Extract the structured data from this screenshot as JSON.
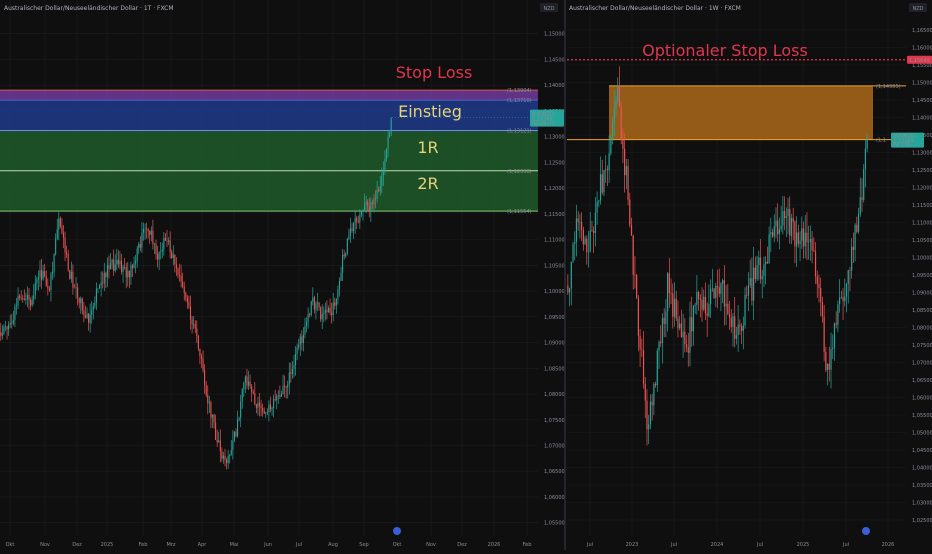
{
  "colors": {
    "background": "#0f0f10",
    "grid": "#1c1d22",
    "up": "#26a69a",
    "down": "#ef5350",
    "stop_red": "#e0364d",
    "label_yellow": "#e7d27a",
    "orange": "#f0a22f",
    "separator": "#2a2e39"
  },
  "charts": [
    {
      "id": "left",
      "title": "Australischer Dollar/Neuseeländischer Dollar · 1T · FXCM",
      "currency": "NZD",
      "price_labels": [
        "1,15000",
        "1,14500",
        "1,14000",
        "1,13500",
        "1,13000",
        "1,12500",
        "1,12000",
        "1,11500",
        "1,11000",
        "1,10500",
        "1,10000",
        "1,09500",
        "1,09000",
        "1,08500",
        "1,08000",
        "1,07500",
        "1,07000",
        "1,06500",
        "1,06000",
        "1,05500"
      ],
      "time_labels": [
        "Okt",
        "Nov",
        "Dez",
        "2025",
        "Feb",
        "Mrz",
        "Apr",
        "Mai",
        "Jun",
        "Jul",
        "Aug",
        "Sep",
        "Okt",
        "Nov",
        "Dez",
        "2026",
        "Feb"
      ],
      "current_price_label": {
        "line1": "AUDNZD",
        "line2": "1,13369",
        "line3": "06:59:07"
      },
      "annotations": {
        "stop": "Stop Loss",
        "entry": "Einstieg",
        "one_r": "1R",
        "two_r": "2R"
      },
      "zone_labels": {
        "stop": "(1,13904)",
        "purple_low": "(1,13710)",
        "entry": "(1,13121)",
        "one_r": "(1,12338)",
        "two_r": "(1,11554)"
      }
    },
    {
      "id": "right",
      "title": "Australischer Dollar/Neuseeländischer Dollar · 1W · FXCM",
      "currency": "NZD",
      "price_labels": [
        "1,16500",
        "1,16000",
        "1,15500",
        "1,15000",
        "1,14500",
        "1,14000",
        "1,13500",
        "1,13000",
        "1,12500",
        "1,12000",
        "1,11500",
        "1,11000",
        "1,10500",
        "1,10000",
        "1,09500",
        "1,09000",
        "1,08500",
        "1,08000",
        "1,07500",
        "1,07000",
        "1,06500",
        "1,06000",
        "1,05500",
        "1,05000",
        "1,04500",
        "1,04000",
        "1,03500",
        "1,03000",
        "1,02500"
      ],
      "time_labels": [
        "Jul",
        "2023",
        "Jul",
        "2024",
        "Jul",
        "2025",
        "Jul",
        "2026"
      ],
      "stop_tag": "1,15649",
      "current_price_label": {
        "line1": "AUDNZD",
        "line2": "1,13369",
        "line3": "0d 17h"
      },
      "annotations": {
        "optional_stop": "Optionaler Stop Loss"
      },
      "zone_labels": {
        "top": "(1,14905)",
        "bottom": "(1,1"
      }
    }
  ],
  "chart_data": [
    {
      "type": "candlestick",
      "title": "Australischer Dollar/Neuseeländischer Dollar · 1T · FXCM",
      "interval": "1T",
      "y_unit": "NZD",
      "ylim": [
        1.053,
        1.155
      ],
      "x_start": "Okt 2024",
      "x_end": "Feb 2026",
      "grid": true,
      "close_path": [
        {
          "t": "Okt",
          "v": 1.092
        },
        {
          "t": "Nov",
          "v": 1.1
        },
        {
          "t": "Dez",
          "v": 1.114
        },
        {
          "t": "2025",
          "v": 1.101
        },
        {
          "t": "Feb",
          "v": 1.113
        },
        {
          "t": "Mrz",
          "v": 1.107
        },
        {
          "t": "Apr",
          "v": 1.072
        },
        {
          "t": "Mai",
          "v": 1.083
        },
        {
          "t": "Jun",
          "v": 1.079
        },
        {
          "t": "Jul",
          "v": 1.089
        },
        {
          "t": "Aug",
          "v": 1.095
        },
        {
          "t": "Sep",
          "v": 1.117
        },
        {
          "t": "Sep-end",
          "v": 1.1337
        }
      ],
      "last_price": 1.13369,
      "zones": [
        {
          "name": "Stop Loss",
          "from": 1.1371,
          "to": 1.13904,
          "color": "#7b3fa8"
        },
        {
          "name": "Einstieg",
          "from": 1.13121,
          "to": 1.1371,
          "color": "#1f3f9c"
        },
        {
          "name": "1R",
          "from": 1.12338,
          "to": 1.13121,
          "color": "#1f5a2a"
        },
        {
          "name": "2R",
          "from": 1.11554,
          "to": 1.12338,
          "color": "#1f5a2a"
        }
      ]
    },
    {
      "type": "candlestick",
      "title": "Australischer Dollar/Neuseeländischer Dollar · 1W · FXCM",
      "interval": "1W",
      "y_unit": "NZD",
      "ylim": [
        1.02,
        1.168
      ],
      "x_start": "Apr 2022",
      "x_end": "Okt 2026",
      "grid": true,
      "close_path": [
        {
          "t": "Jul 2022",
          "v": 1.115
        },
        {
          "t": "Nov 2022",
          "v": 1.148
        },
        {
          "t": "Jan 2023",
          "v": 1.052
        },
        {
          "t": "Jul 2023",
          "v": 1.085
        },
        {
          "t": "2024",
          "v": 1.095
        },
        {
          "t": "Jul 2024",
          "v": 1.113
        },
        {
          "t": "2025",
          "v": 1.104
        },
        {
          "t": "Apr 2025",
          "v": 1.065
        },
        {
          "t": "Jul 2025",
          "v": 1.098
        },
        {
          "t": "Sep 2025",
          "v": 1.1337
        }
      ],
      "last_price": 1.13369,
      "optional_stop": 1.15649,
      "zones": [
        {
          "name": "Optionaler Stop Loss range",
          "from": 1.13369,
          "to": 1.14905,
          "color": "#a3631a"
        }
      ]
    }
  ]
}
